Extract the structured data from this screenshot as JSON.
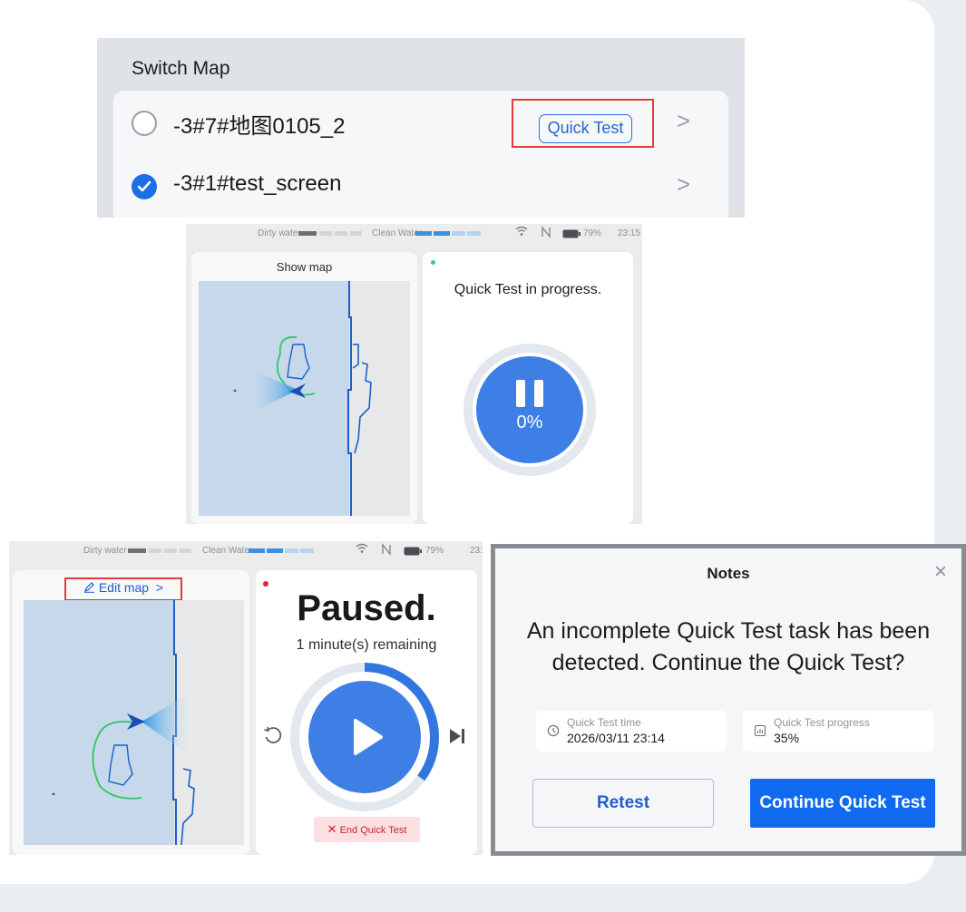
{
  "switch_map": {
    "heading": "Switch Map",
    "maps": [
      {
        "name": "-3#7#地图0105_2",
        "selected": false
      },
      {
        "name": "-3#1#test_screen",
        "selected": true,
        "badge": "Quick Test"
      }
    ],
    "accent_color": "#1c6ee5",
    "highlight_color": "#e23b3b"
  },
  "status_bar_1": {
    "dirty_water_label": "Dirty water",
    "clean_water_label": "Clean Water",
    "battery": "79%",
    "time": "23:15"
  },
  "running_screen": {
    "map_button": "Show map",
    "title": "Quick Test in progress.",
    "progress_text": "0%",
    "progress_value": 0,
    "status_dot_color": "#2ed07a"
  },
  "status_bar_2": {
    "dirty_water_label": "Dirty water",
    "clean_water_label": "Clean Water",
    "battery": "79%",
    "time": "23:"
  },
  "paused_screen": {
    "edit_map": "Edit map",
    "title": "Paused.",
    "remaining": "1 minute(s) remaining",
    "end_button": "End Quick Test",
    "progress_value": 35,
    "status_dot_color": "#e0213a"
  },
  "notes_dialog": {
    "title": "Notes",
    "message": "An incomplete Quick Test task has been detected. Continue the Quick Test?",
    "time_label": "Quick Test time",
    "time_value": "2026/03/11 23:14",
    "progress_label": "Quick Test progress",
    "progress_value": "35%",
    "retest_button": "Retest",
    "continue_button": "Continue Quick Test",
    "primary_color": "#0f6af0"
  }
}
